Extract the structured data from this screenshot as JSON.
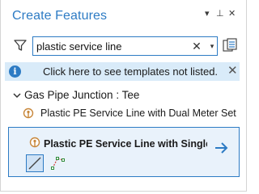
{
  "pane": {
    "title": "Create Features",
    "controls": {
      "menu": "▾",
      "pin": "⊥",
      "close": "✕"
    }
  },
  "search": {
    "value": "plastic service line",
    "clear_glyph": "✕",
    "dropdown_glyph": "▾",
    "icons": {
      "filter": "filter-icon",
      "templates": "manage-templates-icon"
    }
  },
  "info_bar": {
    "icon_glyph": "i",
    "text": "Click here to see templates not listed.",
    "close_glyph": "✕",
    "color": "#d9ebf9"
  },
  "group": {
    "label": "Gas Pipe Junction : Tee",
    "expanded": true
  },
  "templates": [
    {
      "label": "Plastic PE Service Line with Dual Meter Set",
      "selected": false
    },
    {
      "label": "Plastic PE Service Line with Single Meter Set",
      "selected": true
    }
  ],
  "construction_tools": [
    {
      "name": "line-tool",
      "active": true
    },
    {
      "name": "trace-tool",
      "active": false
    }
  ],
  "colors": {
    "accent": "#2d7bc4",
    "selected_bg": "#e9f2fb",
    "point_symbol": "#c8873a"
  }
}
